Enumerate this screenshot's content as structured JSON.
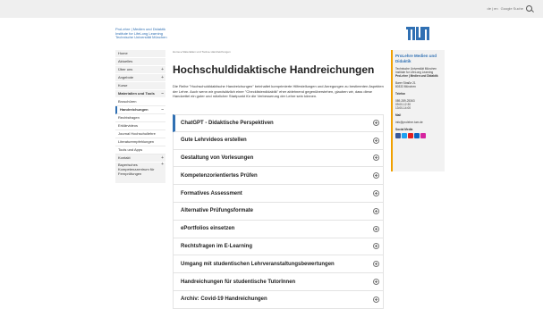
{
  "topbar": {
    "lang": "de | en",
    "search_label": "Google Suche"
  },
  "brand": {
    "line1": "ProLehre | Medien und Didaktik",
    "line2": "Institute for LifeLong Learning",
    "line3": "Technische Universität München",
    "logo_text": "TUM",
    "color": "#3070b3"
  },
  "sidebar": {
    "items": [
      {
        "label": "Home",
        "plus": ""
      },
      {
        "label": "Aktuelles",
        "plus": ""
      },
      {
        "label": "Über uns",
        "plus": "+"
      },
      {
        "label": "Angebote",
        "plus": "+"
      },
      {
        "label": "Kurse",
        "plus": ""
      },
      {
        "label": "Materialien und Tools",
        "plus": "–"
      },
      {
        "label": "Broschüren",
        "plus": ""
      },
      {
        "label": "Handreichungen",
        "plus": "–"
      },
      {
        "label": "Rechtsfragen",
        "plus": ""
      },
      {
        "label": "Erklärvideos",
        "plus": ""
      },
      {
        "label": "Journal Hochschullehre",
        "plus": ""
      },
      {
        "label": "Literaturempfehlungen",
        "plus": ""
      },
      {
        "label": "Tools und Apps",
        "plus": ""
      },
      {
        "label": "Kontakt",
        "plus": "+"
      },
      {
        "label": "Bayerisches Kompetenzzentrum für Fernprüfungen",
        "plus": "+"
      }
    ]
  },
  "main": {
    "breadcrumb": "Home ▸ Materialien und Tools ▸ Handreichungen",
    "title": "Hochschuldidaktische Handreichungen",
    "intro": "Die Reihe \"Hochschuldidaktische Handreichungen\" beinhaltet komprimierte Hilfestellungen und Anregungen zu bestimmten Aspekten der Lehre. Auch wenn wir grundsätzlich einer \"Checklistendidaktik\" eher ablehnend gegenüberstehen, glauben wir, dass diese Handzettel ein guter und nützlicher Startpunkt für die Verbesserung der Lehre sein können."
  },
  "accordion": [
    "ChatGPT - Didaktische Perspektiven",
    "Gute Lehrvideos erstellen",
    "Gestaltung von Vorlesungen",
    "Kompetenzorientiertes Prüfen",
    "Formatives Assessment",
    "Alternative Prüfungsformate",
    "ePortfolios einsetzen",
    "Rechtsfragen im E-Learning",
    "Umgang mit studentischen Lehrveranstaltungsbewertungen",
    "Handreichungen für studentische TutorInnen",
    "Archiv: Covid-19 Handreichungen"
  ],
  "infobox": {
    "title": "ProLehre Medien und Didaktik",
    "org1": "Technische Universität München",
    "org2": "Institute for LifeLong Learning",
    "org3": "ProLehre | Medien und Didaktik",
    "street": "Barer Straße 21",
    "city": "80333 München",
    "phone_label": "Telefon",
    "phone": "089-289-25363",
    "hours1": "09:00-12:30",
    "hours2": "13:00-14:00",
    "mail_label": "Mail",
    "mail": "info@prolehre.tum.de",
    "social_label": "Social Media",
    "accent": "#f0a000"
  }
}
